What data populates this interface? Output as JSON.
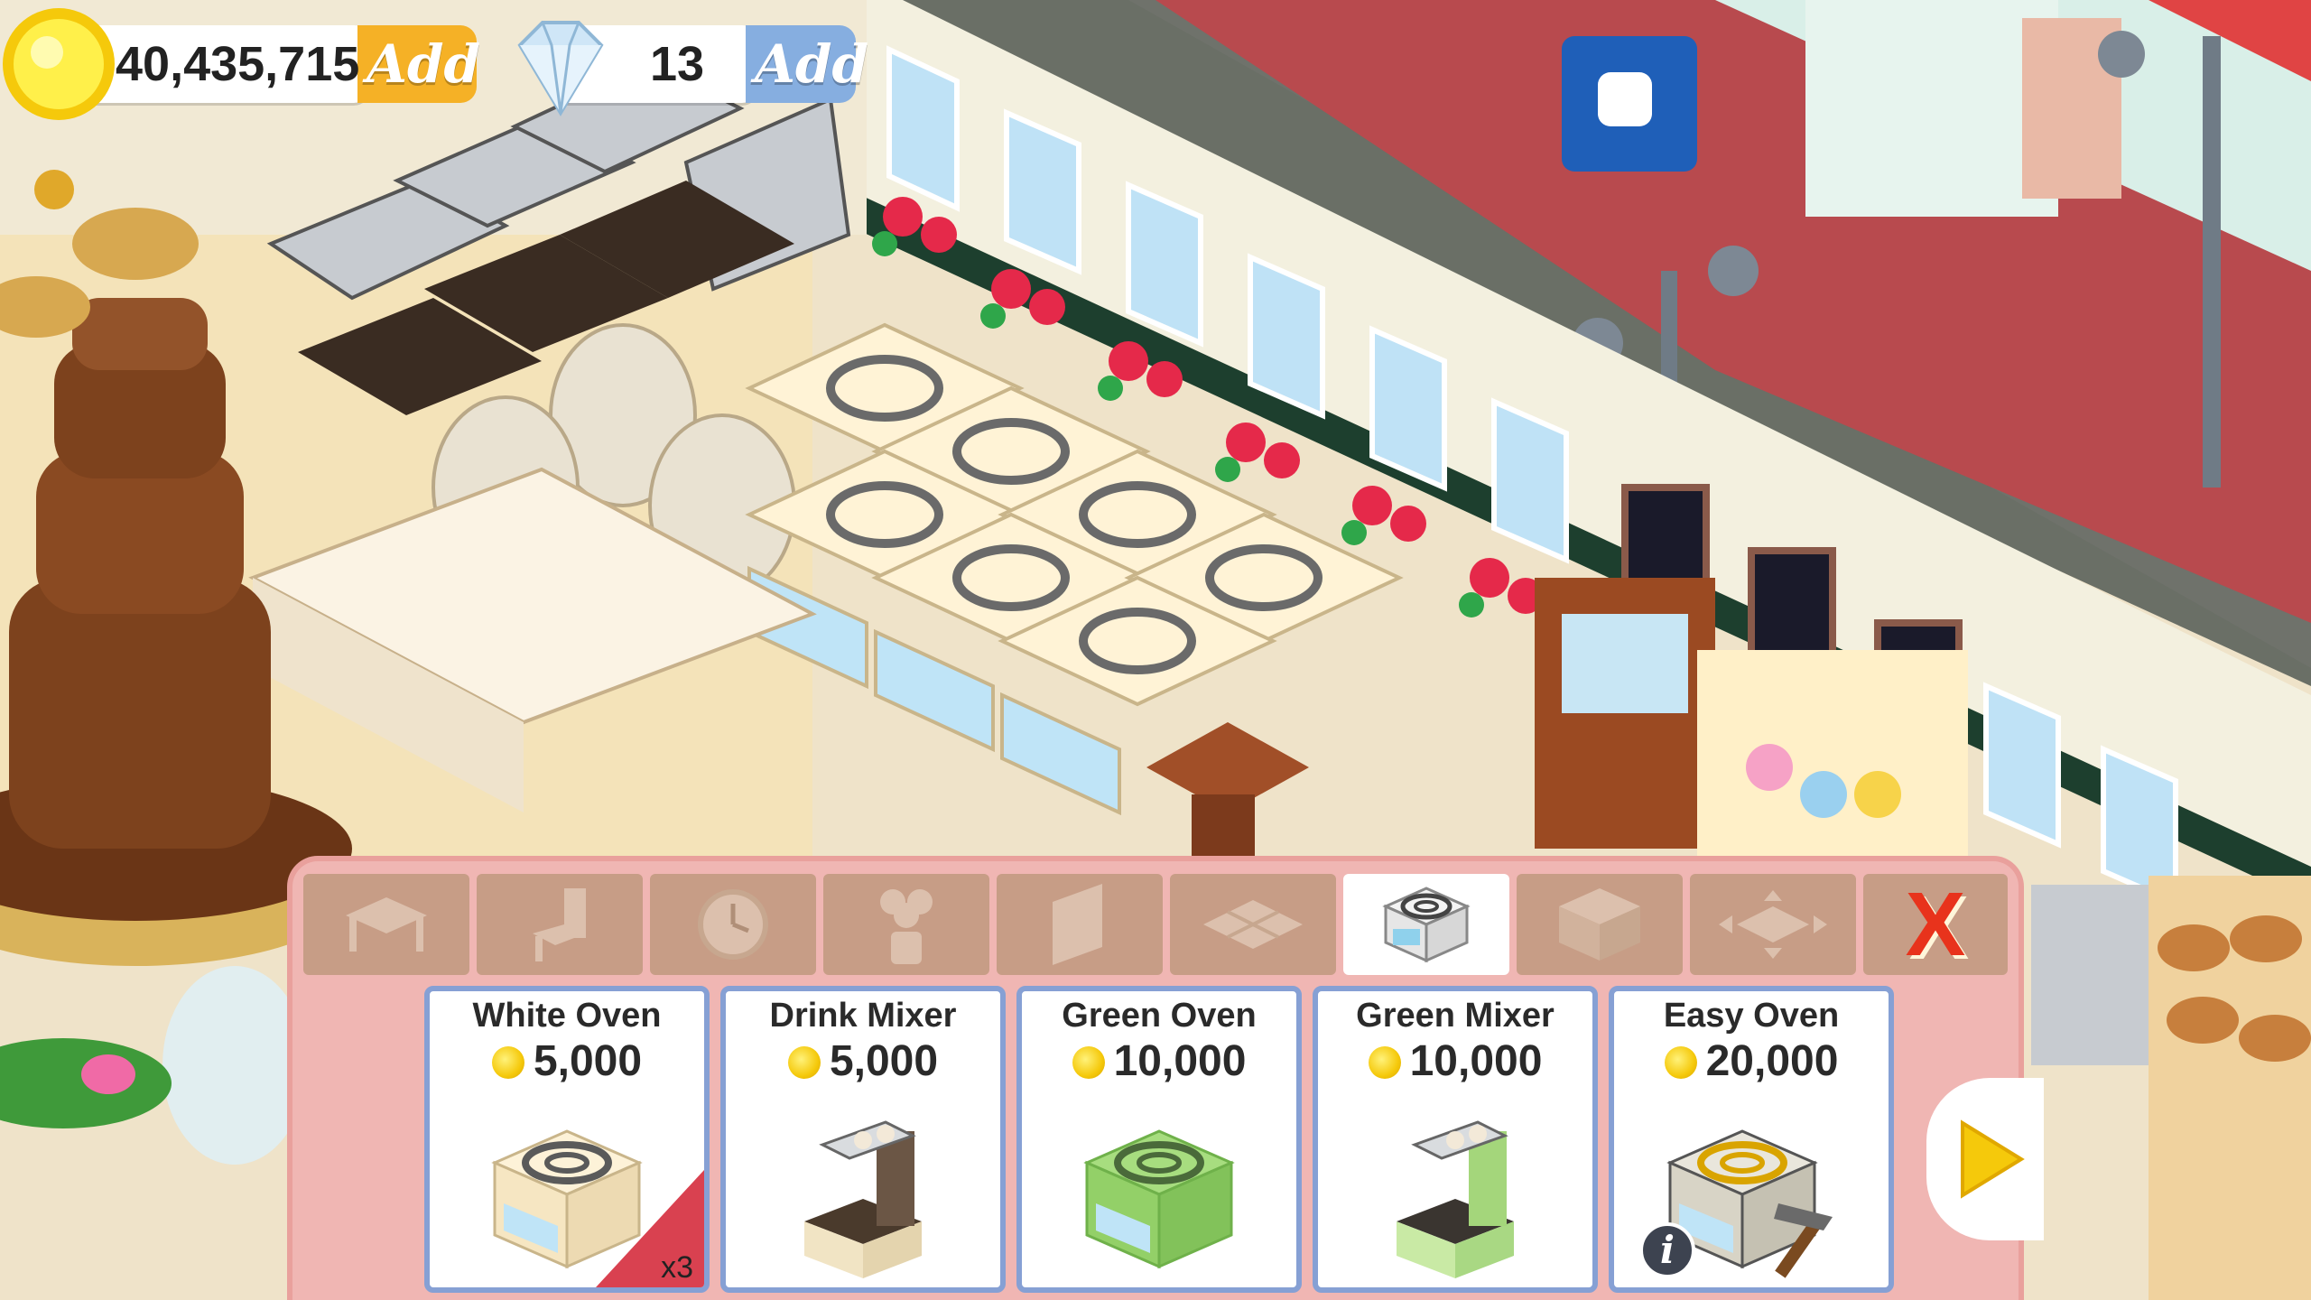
{
  "hud": {
    "coins_value": "40,435,715",
    "coins_add_label": "Add",
    "gems_value": "13",
    "gems_add_label": "Add"
  },
  "shop": {
    "tabs": [
      {
        "icon": "table-icon",
        "active": false
      },
      {
        "icon": "chair-icon",
        "active": false
      },
      {
        "icon": "clock-icon",
        "active": false
      },
      {
        "icon": "plant-icon",
        "active": false
      },
      {
        "icon": "wall-icon",
        "active": false
      },
      {
        "icon": "floor-tile-icon",
        "active": false
      },
      {
        "icon": "stove-icon",
        "active": true
      },
      {
        "icon": "counter-icon",
        "active": false
      },
      {
        "icon": "expand-icon",
        "active": false
      }
    ],
    "close_label": "X",
    "items": [
      {
        "name": "White Oven",
        "price": "5,000",
        "badge": "x3",
        "icon": "white-oven-icon"
      },
      {
        "name": "Drink Mixer",
        "price": "5,000",
        "icon": "drink-mixer-icon"
      },
      {
        "name": "Green Oven",
        "price": "10,000",
        "icon": "green-oven-icon"
      },
      {
        "name": "Green Mixer",
        "price": "10,000",
        "icon": "green-mixer-icon"
      },
      {
        "name": "Easy Oven",
        "price": "20,000",
        "info": "i",
        "icon": "easy-oven-icon"
      }
    ]
  },
  "colors": {
    "panel_bg": "#f0b6b3",
    "tab_bg": "#c79d86",
    "card_border": "#86a0d4",
    "coin_gold": "#f5c90b",
    "close_red": "#e8331c"
  }
}
